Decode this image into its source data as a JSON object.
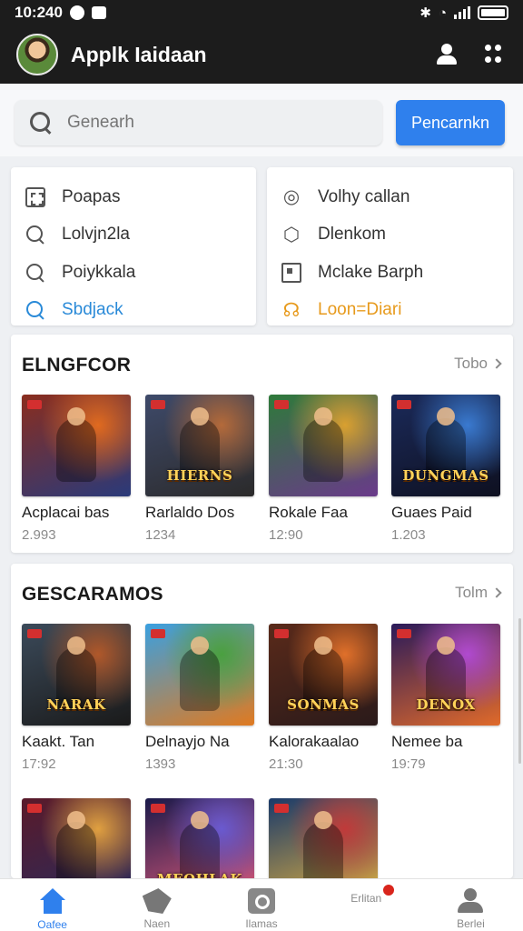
{
  "status_bar": {
    "time": "10:240"
  },
  "app_bar": {
    "title": "Applk Iaidaan"
  },
  "search": {
    "placeholder": "Genearh",
    "button_label": "Pencarnkn"
  },
  "menu_left": [
    {
      "icon": "grid-icon",
      "label": "Poapas",
      "style": "default"
    },
    {
      "icon": "search-icon",
      "label": "Lolvjn2la",
      "style": "default"
    },
    {
      "icon": "magnifier-icon",
      "label": "Poiykkala",
      "style": "default"
    },
    {
      "icon": "search-icon",
      "label": "Sbdjack",
      "style": "blue"
    }
  ],
  "menu_right": [
    {
      "icon": "target-icon",
      "label": "Volhy callan",
      "style": "default"
    },
    {
      "icon": "cube-icon",
      "label": "Dlenkom",
      "style": "default"
    },
    {
      "icon": "box-icon",
      "label": "Mclake Barph",
      "style": "default"
    },
    {
      "icon": "headset-icon",
      "label": "Loon=Diari",
      "style": "orange"
    }
  ],
  "sections": [
    {
      "title": "ELNGFCOR",
      "see_all": "Tobo",
      "games": [
        {
          "title": "Acplacai bas",
          "count": "2.993",
          "logo": "",
          "colors": [
            "#8a2d1e",
            "#e06a1f",
            "#2a3a7a"
          ]
        },
        {
          "title": "Rarlaldo Dos",
          "count": "1234",
          "logo": "HIERNS",
          "colors": [
            "#3e4a6a",
            "#b46a3a",
            "#2b2a2a"
          ]
        },
        {
          "title": "Rokale Faa",
          "count": "12:90",
          "logo": "",
          "colors": [
            "#2e7a3a",
            "#d9a030",
            "#6a3a8a"
          ]
        },
        {
          "title": "Guaes Paid",
          "count": "1.203",
          "logo": "DUNGMAS",
          "colors": [
            "#1b2a5a",
            "#3a7ad0",
            "#0e1020"
          ]
        }
      ]
    },
    {
      "title": "GESCARAMOS",
      "see_all": "Tolm",
      "games": [
        {
          "title": "Kaakt. Tan",
          "count": "17:92",
          "logo": "NARAK",
          "colors": [
            "#3b4a5a",
            "#b0582a",
            "#1a1a1a"
          ]
        },
        {
          "title": "Delnayjo Na",
          "count": "1393",
          "logo": "",
          "colors": [
            "#3aa0e0",
            "#4aa040",
            "#e07a20"
          ]
        },
        {
          "title": "Kalorakaalao",
          "count": "21:30",
          "logo": "SONMAS",
          "colors": [
            "#5a2a1a",
            "#e0702a",
            "#2a1a1a"
          ]
        },
        {
          "title": "Nemee ba",
          "count": "19:79",
          "logo": "DENOX",
          "colors": [
            "#2a1a5a",
            "#b04ad0",
            "#e06a2a"
          ]
        },
        {
          "title": "",
          "count": "",
          "logo": "",
          "colors": [
            "#5a1a2a",
            "#e0a040",
            "#2a2a5a"
          ]
        },
        {
          "title": "",
          "count": "",
          "logo": "MEOHLAK",
          "colors": [
            "#1a1a4a",
            "#6a5ad0",
            "#e05a7a"
          ]
        },
        {
          "title": "",
          "count": "",
          "logo": "",
          "colors": [
            "#1a3a6a",
            "#c03a3a",
            "#e0b040"
          ]
        }
      ]
    }
  ],
  "tabs": [
    {
      "icon": "home-icon",
      "label": "Oafee",
      "active": true
    },
    {
      "icon": "news-icon",
      "label": "Naen",
      "active": false
    },
    {
      "icon": "games-icon",
      "label": "Ilamas",
      "active": false
    },
    {
      "icon": "notification-icon",
      "label": "Erlitan",
      "active": false
    },
    {
      "icon": "profile-icon",
      "label": "Berlei",
      "active": false
    }
  ],
  "colors": {
    "accent": "#2f80ed",
    "appbar": "#1c1c1c",
    "highlight_blue": "#2a8ad8",
    "highlight_orange": "#e79a1c",
    "notification": "#d9251c"
  }
}
